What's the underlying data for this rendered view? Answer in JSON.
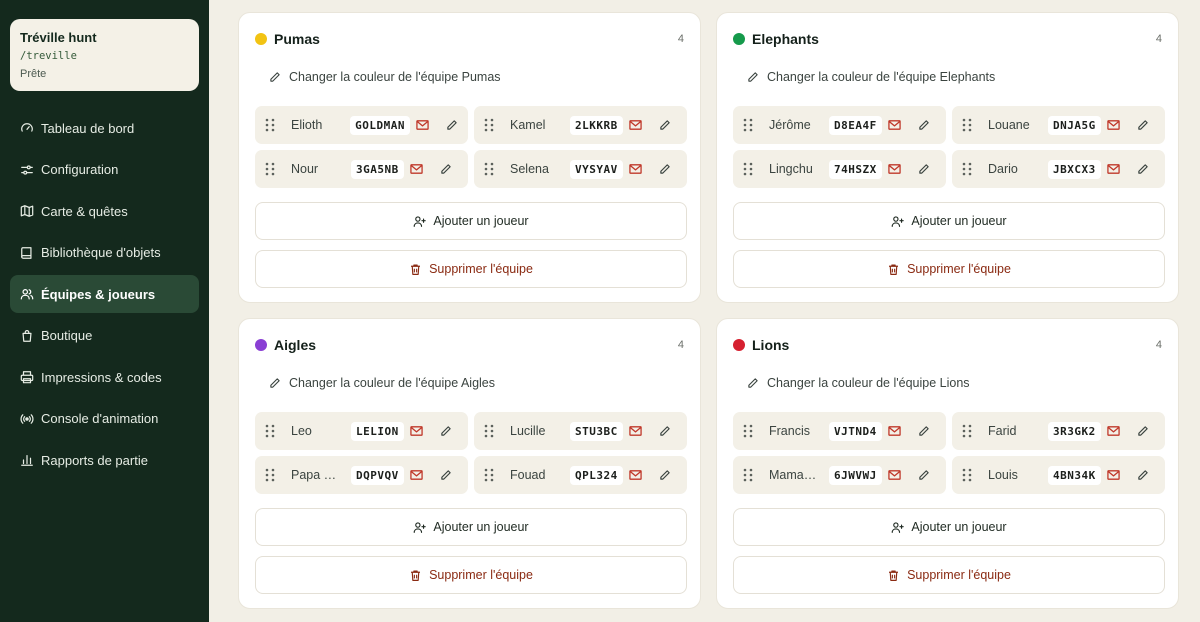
{
  "sidebar": {
    "hunt": {
      "title": "Tréville hunt",
      "slug": "/treville",
      "status": "Prête"
    },
    "items": [
      {
        "label": "Tableau de bord",
        "icon": "gauge-icon"
      },
      {
        "label": "Configuration",
        "icon": "sliders-icon"
      },
      {
        "label": "Carte & quêtes",
        "icon": "map-icon"
      },
      {
        "label": "Bibliothèque d'objets",
        "icon": "book-icon"
      },
      {
        "label": "Équipes & joueurs",
        "icon": "users-icon",
        "active": true
      },
      {
        "label": "Boutique",
        "icon": "shopping-bag-icon"
      },
      {
        "label": "Impressions & codes",
        "icon": "printer-icon"
      },
      {
        "label": "Console d'animation",
        "icon": "broadcast-icon"
      },
      {
        "label": "Rapports de partie",
        "icon": "bar-chart-icon"
      }
    ]
  },
  "teams": [
    {
      "name": "Pumas",
      "color": "#f2c313",
      "count": "4",
      "color_link": "Changer la couleur de l'équipe Pumas",
      "players": [
        {
          "name": "Elioth",
          "code": "GOLDMAN"
        },
        {
          "name": "Kamel",
          "code": "2LKKRB"
        },
        {
          "name": "Nour",
          "code": "3GA5NB"
        },
        {
          "name": "Selena",
          "code": "VYSYAV"
        }
      ],
      "add_label": "Ajouter un joueur",
      "delete_label": "Supprimer l'équipe"
    },
    {
      "name": "Elephants",
      "color": "#159a4b",
      "count": "4",
      "color_link": "Changer la couleur de l'équipe Elephants",
      "players": [
        {
          "name": "Jérôme",
          "code": "D8EA4F"
        },
        {
          "name": "Louane",
          "code": "DNJA5G"
        },
        {
          "name": "Lingchu",
          "code": "74HSZX"
        },
        {
          "name": "Dario",
          "code": "JBXCX3"
        }
      ],
      "add_label": "Ajouter un joueur",
      "delete_label": "Supprimer l'équipe"
    },
    {
      "name": "Aigles",
      "color": "#8a3fd4",
      "count": "4",
      "color_link": "Changer la couleur de l'équipe Aigles",
      "players": [
        {
          "name": "Leo",
          "code": "LELION"
        },
        {
          "name": "Lucille",
          "code": "STU3BC"
        },
        {
          "name": "Papa Jé...",
          "code": "DQPVQV"
        },
        {
          "name": "Fouad",
          "code": "QPL324"
        }
      ],
      "add_label": "Ajouter un joueur",
      "delete_label": "Supprimer l'équipe"
    },
    {
      "name": "Lions",
      "color": "#d62030",
      "count": "4",
      "color_link": "Changer la couleur de l'équipe Lions",
      "players": [
        {
          "name": "Francis",
          "code": "VJTND4"
        },
        {
          "name": "Farid",
          "code": "3R3GK2"
        },
        {
          "name": "Maman ...",
          "code": "6JWVWJ"
        },
        {
          "name": "Louis",
          "code": "4BN34K"
        }
      ],
      "add_label": "Ajouter un joueur",
      "delete_label": "Supprimer l'équipe"
    }
  ],
  "colors": {
    "sidebar_bg": "#14291d",
    "active_bg": "#2a4a36",
    "danger": "#8a2a12",
    "mail": "#c0392b"
  }
}
